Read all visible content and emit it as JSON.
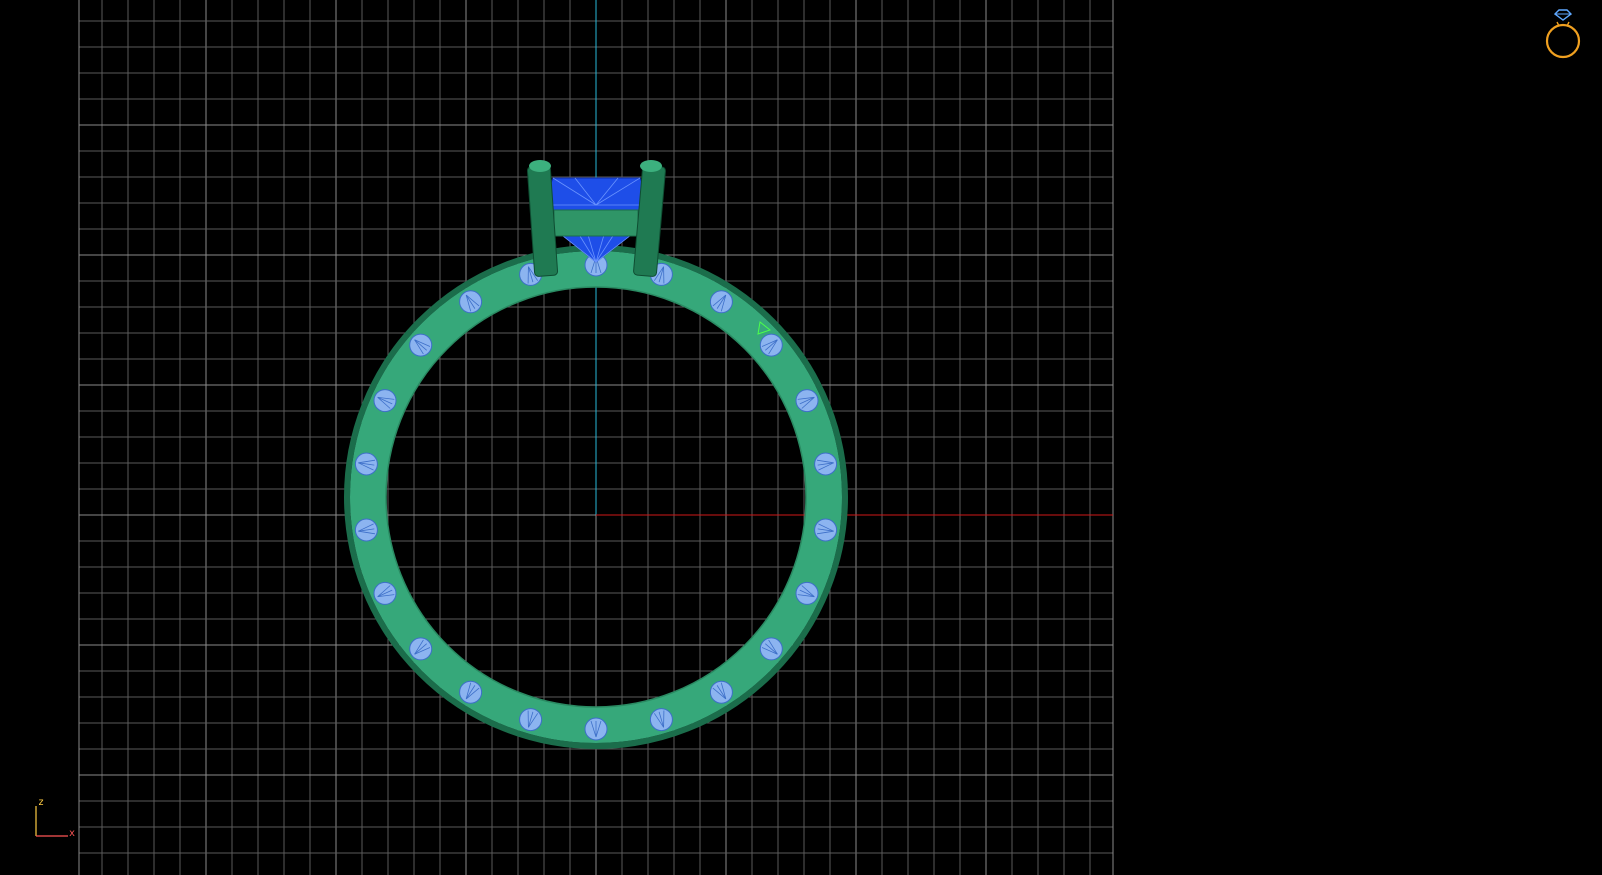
{
  "viewport": {
    "view": "front",
    "background": "#000000",
    "grid_color": "#5a5a5a",
    "grid_major_color": "#8a8a8a",
    "axis_vertical_color": "#29b8d8",
    "axis_horizontal_color": "#d01818"
  },
  "model": {
    "band_color": "#36a87a",
    "band_edge_color": "#1b6d4b",
    "prong_color": "#1f7a52",
    "stone_color": "#1e4ee8",
    "melee_color": "#8cb4f0",
    "melee_count": 22
  },
  "view_cube": {
    "icon": "ring-icon",
    "color": "#f0a020"
  },
  "axis_widget": {
    "z_label": "z",
    "x_label": "x",
    "z_color": "#ffcc44",
    "x_color": "#ff5555"
  }
}
